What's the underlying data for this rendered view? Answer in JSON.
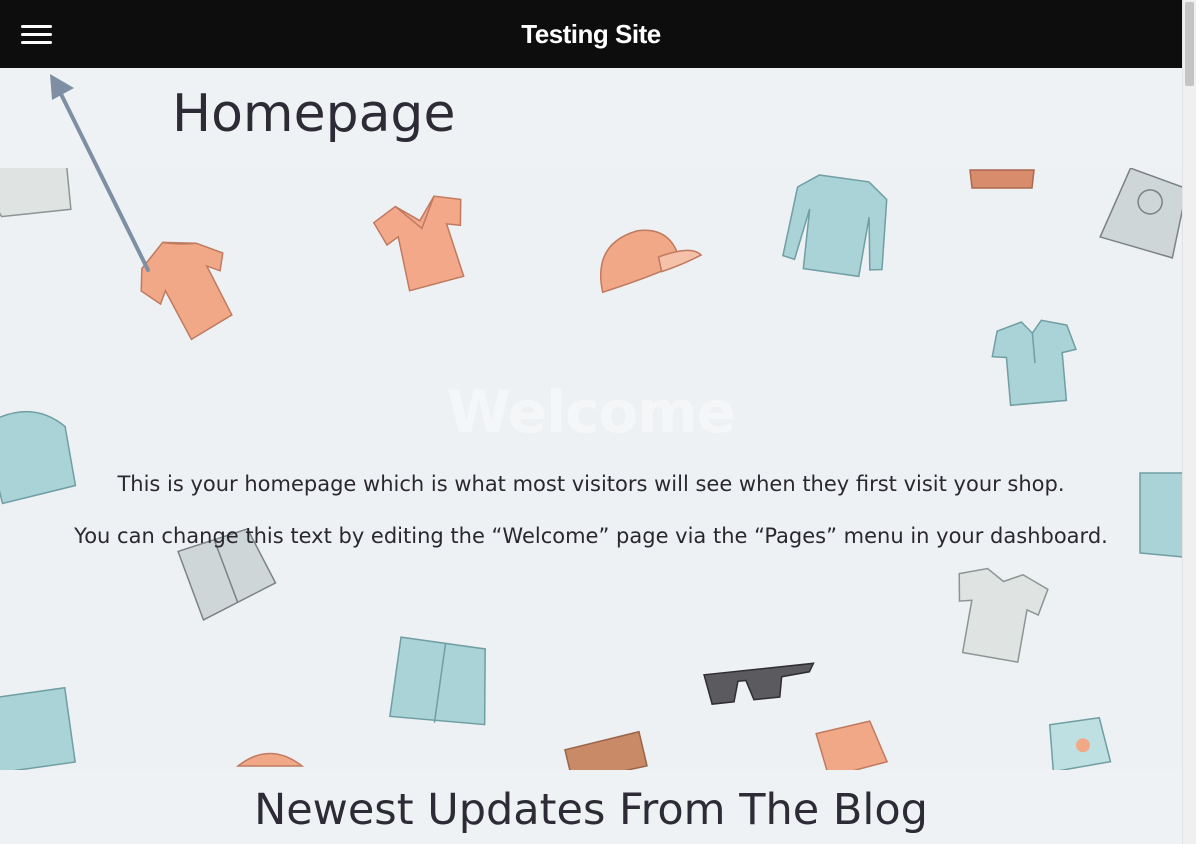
{
  "header": {
    "site_title": "Testing Site",
    "menu_icon": "hamburger-menu-icon"
  },
  "page": {
    "title": "Homepage"
  },
  "hero": {
    "heading": "Welcome",
    "paragraph_1": "This is your homepage which is what most visitors will see when they first visit your shop.",
    "paragraph_2": "You can change this text by editing the “Welcome” page via the “Pages” menu in your dashboard."
  },
  "blog": {
    "heading": "Newest Updates From The Blog"
  },
  "colors": {
    "topbar": "#0d0d0d",
    "page_bg": "#eff2f5",
    "accent_coral": "#f0a887",
    "accent_teal": "#a9d3d6",
    "annotation_arrow": "#7f8fa3"
  }
}
